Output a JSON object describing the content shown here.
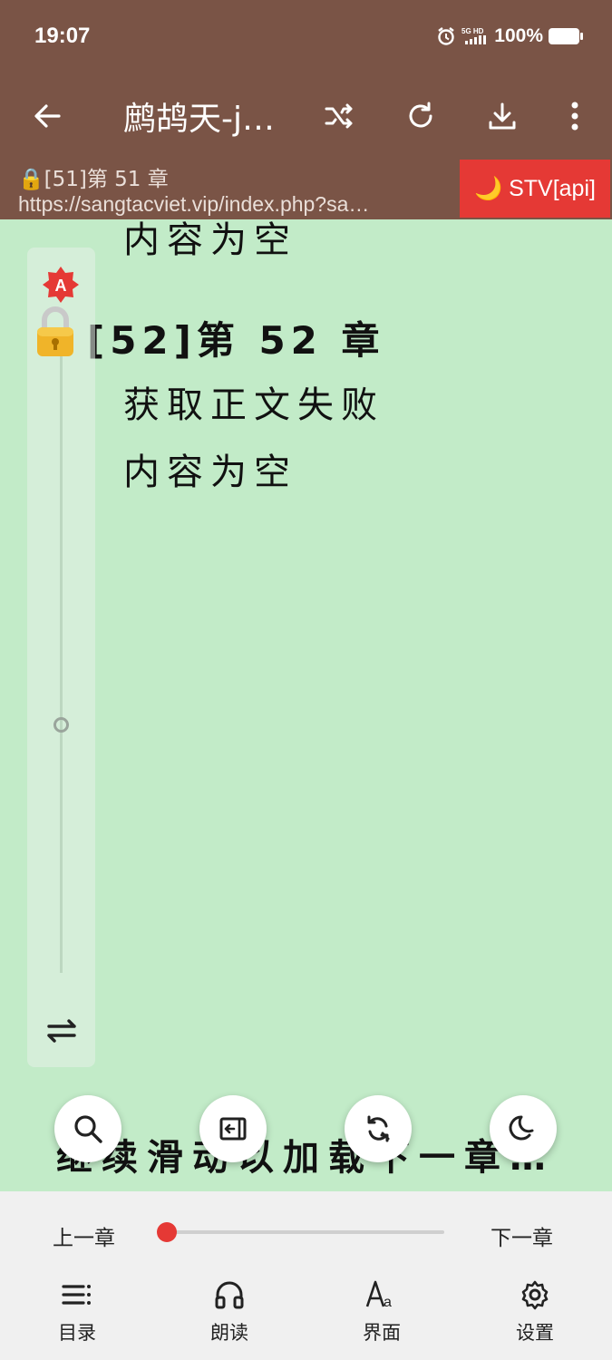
{
  "status_bar": {
    "time": "19:07",
    "network": "5G HD",
    "battery": "100%"
  },
  "toolbar": {
    "title": "鹧鸪天-j…"
  },
  "info_bar": {
    "chapter": "🔒[51]第 51 章",
    "url": "https://sangtacviet.vip/index.php?sa…",
    "source": "🌙 STV[api]"
  },
  "content": {
    "prev_tail": "内容为空",
    "chapter_heading": "[52]第 52 章",
    "lines": [
      "获取正文失败",
      "内容为空"
    ],
    "load_hint": "继续滑动以加载下一章…"
  },
  "scroll_panel": {
    "auto_label": "A"
  },
  "bottom": {
    "prev_chapter": "上一章",
    "next_chapter": "下一章",
    "progress": 0,
    "nav": [
      {
        "label": "目录",
        "icon": "list-icon"
      },
      {
        "label": "朗读",
        "icon": "headphones-icon"
      },
      {
        "label": "界面",
        "icon": "font-icon"
      },
      {
        "label": "设置",
        "icon": "gear-icon"
      }
    ]
  },
  "colors": {
    "toolbar_bg": "#7a5446",
    "page_bg": "#c2ebc8",
    "accent": "#e53935"
  }
}
